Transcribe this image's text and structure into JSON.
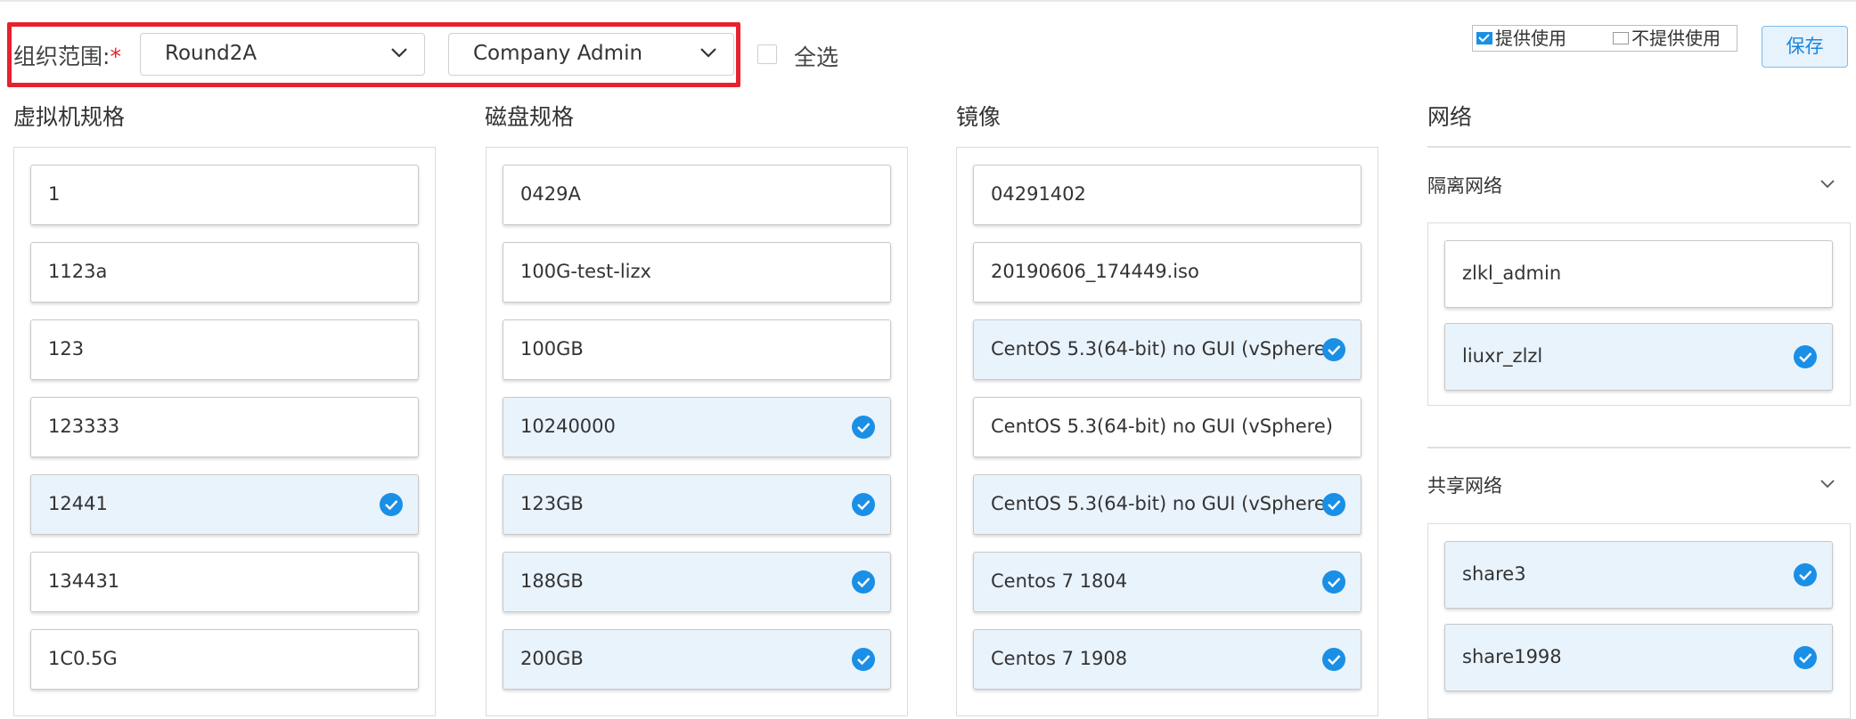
{
  "header": {
    "org_label": "组织范围:",
    "required_mark": "*",
    "org_select_1": "Round2A",
    "org_select_2": "Company Admin",
    "select_all_label": "全选",
    "provide_label": "提供使用",
    "not_provide_label": "不提供使用",
    "save_label": "保存"
  },
  "colors": {
    "accent": "#1a8fe6",
    "highlight_border": "#e8212e",
    "selected_bg": "#e9f3fc"
  },
  "columns": [
    {
      "title": "虚拟机规格",
      "items": [
        {
          "label": "1",
          "selected": false
        },
        {
          "label": "1123a",
          "selected": false
        },
        {
          "label": "123",
          "selected": false
        },
        {
          "label": "123333",
          "selected": false
        },
        {
          "label": "12441",
          "selected": true
        },
        {
          "label": "134431",
          "selected": false
        },
        {
          "label": "1C0.5G",
          "selected": false
        }
      ]
    },
    {
      "title": "磁盘规格",
      "items": [
        {
          "label": "0429A",
          "selected": false
        },
        {
          "label": "100G-test-lizx",
          "selected": false
        },
        {
          "label": "100GB",
          "selected": false
        },
        {
          "label": "10240000",
          "selected": true
        },
        {
          "label": "123GB",
          "selected": true
        },
        {
          "label": "188GB",
          "selected": true
        },
        {
          "label": "200GB",
          "selected": true
        }
      ]
    },
    {
      "title": "镜像",
      "items": [
        {
          "label": "04291402",
          "selected": false
        },
        {
          "label": "20190606_174449.iso",
          "selected": false
        },
        {
          "label": "CentOS 5.3(64-bit) no GUI (vSphere)",
          "selected": true
        },
        {
          "label": "CentOS 5.3(64-bit) no GUI (vSphere)",
          "selected": false
        },
        {
          "label": "CentOS 5.3(64-bit) no GUI (vSphere)",
          "selected": true
        },
        {
          "label": "Centos 7 1804",
          "selected": true
        },
        {
          "label": "Centos 7 1908",
          "selected": true
        }
      ]
    }
  ],
  "network": {
    "title": "网络",
    "sections": [
      {
        "title": "隔离网络",
        "items": [
          {
            "label": "zlkl_admin",
            "selected": false
          },
          {
            "label": "liuxr_zlzl",
            "selected": true
          }
        ]
      },
      {
        "title": "共享网络",
        "items": [
          {
            "label": "share3",
            "selected": true
          },
          {
            "label": "share1998",
            "selected": true
          }
        ]
      }
    ]
  }
}
